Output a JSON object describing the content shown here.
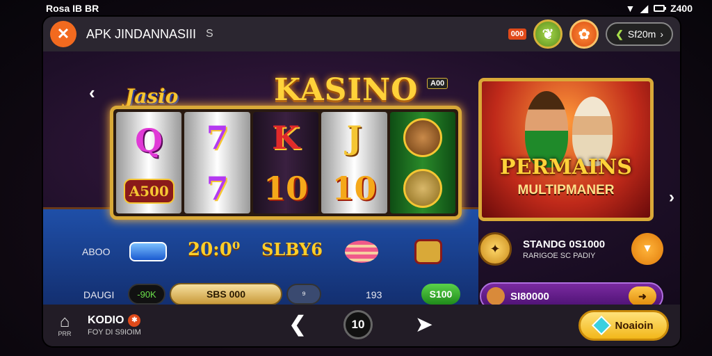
{
  "status_bar": {
    "left_text": "Rosa IB BR",
    "right_text": "Z400"
  },
  "topbar": {
    "close_glyph": "✕",
    "title": "APK JINDANNASIII",
    "subtitle": "S",
    "mini_badge": "000",
    "pill_label": "Sf20m"
  },
  "game": {
    "logo_small": "Jasio",
    "logo_main": "KASINO",
    "corner_badge": "A00",
    "reels": [
      [
        "Q",
        "A500"
      ],
      [
        "7",
        "7"
      ],
      [
        "K",
        "10"
      ],
      [
        "J",
        "10"
      ],
      [
        "",
        ""
      ]
    ],
    "row1_label": "ABOO",
    "row1_amount": "20:0⁰",
    "row1_brand": "SLBY6",
    "row2_label": "DAUGI",
    "row2_pill_left": "-90K",
    "row2_pill_gold": "SBS 000",
    "row2_pill_small": "⁹",
    "row2_value": "193",
    "row2_pill_green": "S100"
  },
  "promo": {
    "title": "PERMAINS",
    "subtitle": "MULTIPMANER",
    "row_line1": "STANDG 0S1000",
    "row_line2": "RARIGOE SC PADIY",
    "purple_bar_label": "SI80000"
  },
  "bottombar": {
    "home_label": "PRR",
    "title": "KODIO",
    "subtitle": "FOY DI S9IOIM",
    "mid_label": "10",
    "play_label": "Noaioin"
  },
  "colors": {
    "accent_orange": "#f26a1f",
    "gold": "#d9a938",
    "felt_blue": "#1f4fa8",
    "purple": "#7a2aa0"
  }
}
